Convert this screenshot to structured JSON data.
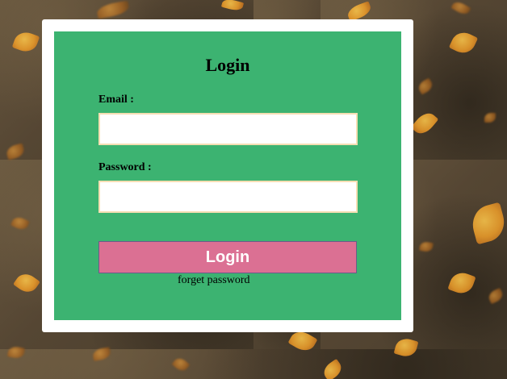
{
  "login": {
    "title": "Login",
    "email_label": "Email :",
    "email_value": "",
    "password_label": "Password :",
    "password_value": "",
    "login_button": "Login",
    "forget_link": "forget password"
  },
  "colors": {
    "card_background": "#3cb371",
    "frame_background": "#ffffff",
    "button_background": "#db7093",
    "input_border": "#f5deb3"
  }
}
